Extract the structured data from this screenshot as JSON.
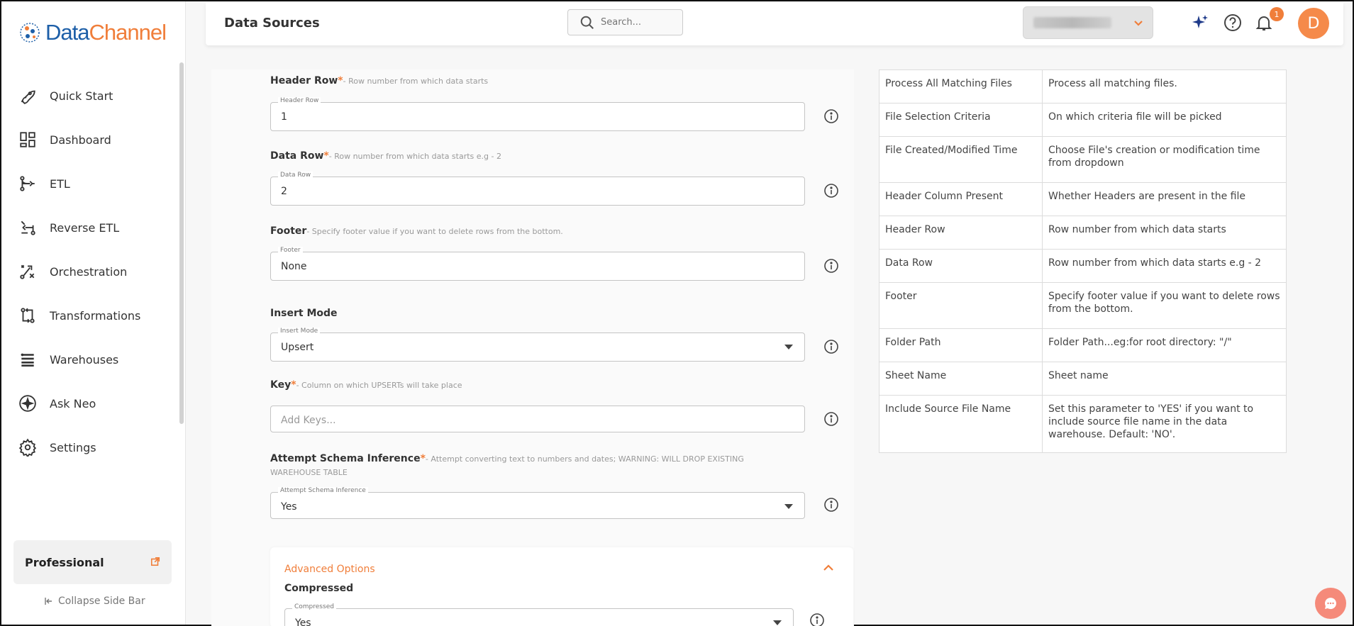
{
  "app": {
    "logo_part1": "Data",
    "logo_part2": "Channel"
  },
  "sidebar": {
    "items": [
      {
        "label": "Quick Start",
        "icon": "rocket-icon"
      },
      {
        "label": "Dashboard",
        "icon": "dashboard-icon"
      },
      {
        "label": "ETL",
        "icon": "etl-icon"
      },
      {
        "label": "Reverse ETL",
        "icon": "reverse-etl-icon"
      },
      {
        "label": "Orchestration",
        "icon": "orchestration-icon"
      },
      {
        "label": "Transformations",
        "icon": "transformations-icon"
      },
      {
        "label": "Warehouses",
        "icon": "warehouses-icon"
      },
      {
        "label": "Ask Neo",
        "icon": "sparkle-icon"
      },
      {
        "label": "Settings",
        "icon": "gear-icon"
      }
    ],
    "plan": "Professional",
    "collapse_label": "Collapse Side Bar"
  },
  "header": {
    "title": "Data Sources",
    "search_placeholder": "Search...",
    "notification_count": "1",
    "avatar_initial": "D"
  },
  "form": {
    "header_row": {
      "label": "Header Row",
      "required": "*",
      "desc": "- Row number from which data starts",
      "floating": "Header Row",
      "value": "1"
    },
    "data_row": {
      "label": "Data Row",
      "required": "*",
      "desc": "- Row number from which data starts e.g - 2",
      "floating": "Data Row",
      "value": "2"
    },
    "footer": {
      "label": "Footer",
      "desc": "- Specify footer value if you want to delete rows from the bottom.",
      "floating": "Footer",
      "value": "None"
    },
    "insert_mode": {
      "label": "Insert Mode",
      "floating": "Insert Mode",
      "value": "Upsert"
    },
    "key": {
      "label": "Key",
      "required": "*",
      "desc": "- Column on which UPSERTs will take place",
      "placeholder": "Add Keys..."
    },
    "schema_inference": {
      "label": "Attempt Schema Inference",
      "required": "*",
      "desc": "- Attempt converting text to numbers and dates; WARNING: WILL DROP EXISTING",
      "desc2": "WAREHOUSE TABLE",
      "floating": "Attempt Schema Inference",
      "value": "Yes"
    },
    "advanced": {
      "title": "Advanced Options",
      "compressed_label": "Compressed",
      "compressed_floating": "Compressed",
      "compressed_value": "Yes"
    }
  },
  "help_table": [
    {
      "k": "Process All Matching Files",
      "v": "Process all matching files."
    },
    {
      "k": "File Selection Criteria",
      "v": "On which criteria file will be picked"
    },
    {
      "k": "File Created/Modified Time",
      "v": "Choose File's creation or modification time from dropdown"
    },
    {
      "k": "Header Column Present",
      "v": "Whether Headers are present in the file"
    },
    {
      "k": "Header Row",
      "v": "Row number from which data starts"
    },
    {
      "k": "Data Row",
      "v": "Row number from which data starts e.g - 2"
    },
    {
      "k": "Footer",
      "v": "Specify footer value if you want to delete rows from the bottom."
    },
    {
      "k": "Folder Path",
      "v": "Folder Path...eg:for root directory: \"/\""
    },
    {
      "k": "Sheet Name",
      "v": "Sheet name"
    },
    {
      "k": "Include Source File Name",
      "v": "Set this parameter to 'YES' if you want to include source file name in the data warehouse. Default: 'NO'."
    }
  ],
  "colors": {
    "accent": "#f07e3a",
    "brand_blue": "#1d5fa8"
  }
}
